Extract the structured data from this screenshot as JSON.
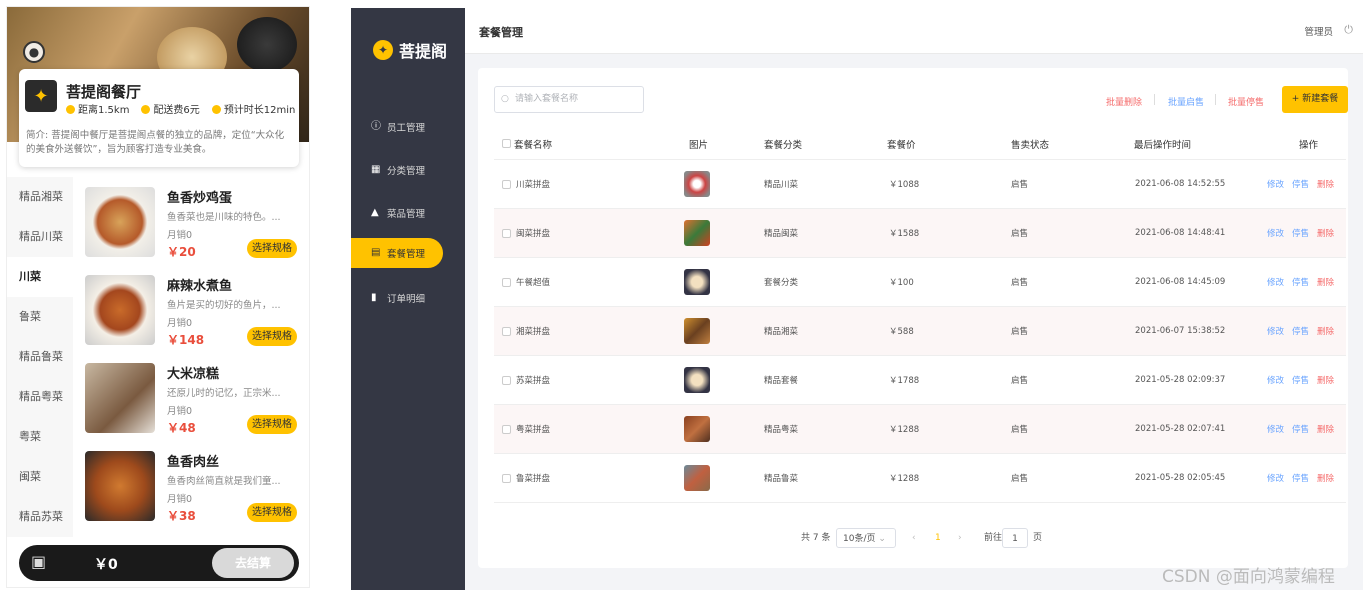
{
  "mobile": {
    "restaurant_name": "菩提阁餐厅",
    "distance": "距离1.5km",
    "delivery_fee": "配送费6元",
    "eta": "预计时长12min",
    "intro": "简介: 菩提阁中餐厅是菩提阁点餐的独立的品牌，定位“大众化的美食外送餐饮”，旨为顾客打造专业美食。",
    "categories": [
      "精品湘菜",
      "精品川菜",
      "川菜",
      "鲁菜",
      "精品鲁菜",
      "精品粤菜",
      "粤菜",
      "闽菜",
      "精品苏菜"
    ],
    "active_category": "川菜",
    "dishes": [
      {
        "name": "鱼香炒鸡蛋",
        "desc": "鱼香菜也是川味的特色。...",
        "sales": "月销0",
        "price": "￥20",
        "button": "选择规格"
      },
      {
        "name": "麻辣水煮鱼",
        "desc": "鱼片是买的切好的鱼片，...",
        "sales": "月销0",
        "price": "￥148",
        "button": "选择规格"
      },
      {
        "name": "大米凉糕",
        "desc": "还原儿时的记忆，正宗米...",
        "sales": "月销0",
        "price": "￥48",
        "button": "选择规格"
      },
      {
        "name": "鱼香肉丝",
        "desc": "鱼香肉丝简直就是我们童...",
        "sales": "月销0",
        "price": "￥38",
        "button": "选择规格"
      }
    ],
    "cart_total": "￥0",
    "checkout": "去结算"
  },
  "admin": {
    "brand": "菩提阁",
    "nav": [
      {
        "label": "员工管理",
        "icon": "info-icon"
      },
      {
        "label": "分类管理",
        "icon": "grid-icon"
      },
      {
        "label": "菜品管理",
        "icon": "dish-icon"
      },
      {
        "label": "套餐管理",
        "icon": "gift-icon"
      },
      {
        "label": "订单明细",
        "icon": "clipboard-icon"
      }
    ],
    "active_nav": "套餐管理",
    "page_title": "套餐管理",
    "user": "管理员",
    "search_placeholder": "请输入套餐名称",
    "batch_delete": "批量删除",
    "batch_enable": "批量启售",
    "batch_disable": "批量停售",
    "new_button": "+ 新建套餐",
    "columns": [
      "套餐名称",
      "图片",
      "套餐分类",
      "套餐价",
      "售卖状态",
      "最后操作时间",
      "操作"
    ],
    "rows": [
      {
        "name": "川菜拼盘",
        "category": "精品川菜",
        "price": "￥1088",
        "status": "启售",
        "time": "2021-06-08 14:52:55"
      },
      {
        "name": "闽菜拼盘",
        "category": "精品闽菜",
        "price": "￥1588",
        "status": "启售",
        "time": "2021-06-08 14:48:41"
      },
      {
        "name": "午餐超值",
        "category": "套餐分类",
        "price": "￥100",
        "status": "启售",
        "time": "2021-06-08 14:45:09"
      },
      {
        "name": "湘菜拼盘",
        "category": "精品湘菜",
        "price": "￥588",
        "status": "启售",
        "time": "2021-06-07 15:38:52"
      },
      {
        "name": "苏菜拼盘",
        "category": "精品套餐",
        "price": "￥1788",
        "status": "启售",
        "time": "2021-05-28 02:09:37"
      },
      {
        "name": "粤菜拼盘",
        "category": "精品粤菜",
        "price": "￥1288",
        "status": "启售",
        "time": "2021-05-28 02:07:41"
      },
      {
        "name": "鲁菜拼盘",
        "category": "精品鲁菜",
        "price": "￥1288",
        "status": "启售",
        "time": "2021-05-28 02:05:45"
      }
    ],
    "op_edit": "修改",
    "op_stop": "停售",
    "op_delete": "删除",
    "pager": {
      "total": "共 7 条",
      "size": "10条/页",
      "current": "1",
      "goto": "前往",
      "page_input": "1",
      "page_suffix": "页"
    }
  },
  "watermark": "CSDN @面向鸿蒙编程",
  "colors": {
    "accent": "#ffc200",
    "sidebar": "#343744",
    "price_red": "#e94e3c",
    "link_blue": "#6aa4ff",
    "delete_red": "#f56c6c"
  }
}
